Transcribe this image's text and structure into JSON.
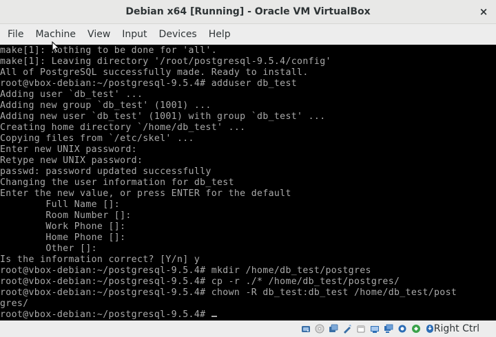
{
  "window": {
    "title": "Debian x64 [Running] - Oracle VM VirtualBox",
    "close_icon": "×"
  },
  "menubar": {
    "items": [
      {
        "label": "File"
      },
      {
        "label": "Machine"
      },
      {
        "label": "View"
      },
      {
        "label": "Input"
      },
      {
        "label": "Devices"
      },
      {
        "label": "Help"
      }
    ]
  },
  "terminal": {
    "lines": [
      "make[1]: Nothing to be done for 'all'.",
      "make[1]: Leaving directory '/root/postgresql-9.5.4/config'",
      "All of PostgreSQL successfully made. Ready to install.",
      "root@vbox-debian:~/postgresql-9.5.4# adduser db_test",
      "Adding user `db_test' ...",
      "Adding new group `db_test' (1001) ...",
      "Adding new user `db_test' (1001) with group `db_test' ...",
      "Creating home directory `/home/db_test' ...",
      "Copying files from `/etc/skel' ...",
      "Enter new UNIX password:",
      "Retype new UNIX password:",
      "passwd: password updated successfully",
      "Changing the user information for db_test",
      "Enter the new value, or press ENTER for the default",
      "        Full Name []:",
      "        Room Number []:",
      "        Work Phone []:",
      "        Home Phone []:",
      "        Other []:",
      "Is the information correct? [Y/n] y",
      "root@vbox-debian:~/postgresql-9.5.4# mkdir /home/db_test/postgres",
      "root@vbox-debian:~/postgresql-9.5.4# cp -r ./* /home/db_test/postgres/",
      "root@vbox-debian:~/postgresql-9.5.4# chown -R db_test:db_test /home/db_test/post",
      "gres/",
      "root@vbox-debian:~/postgresql-9.5.4# "
    ]
  },
  "statusbar": {
    "icons": [
      {
        "name": "hard-disk-icon",
        "color": "#3a6ea5"
      },
      {
        "name": "optical-drive-icon",
        "color": "#9a9a9a"
      },
      {
        "name": "audio-icon",
        "color": "#3a6ea5"
      },
      {
        "name": "network-icon",
        "color": "#3a6ea5"
      },
      {
        "name": "usb-icon",
        "color": "#3a6ea5"
      },
      {
        "name": "shared-folders-icon",
        "color": "#bdbdbd"
      },
      {
        "name": "display-icon",
        "color": "#2d6db5"
      },
      {
        "name": "video-capture-icon",
        "color": "#2d6db5"
      },
      {
        "name": "cpu-icon",
        "color": "#2d6db5"
      },
      {
        "name": "mouse-integration-icon",
        "color": "#2d6db5"
      },
      {
        "name": "keyboard-capture-icon",
        "color": "#2d6db5"
      }
    ],
    "host_key": "Right Ctrl"
  }
}
